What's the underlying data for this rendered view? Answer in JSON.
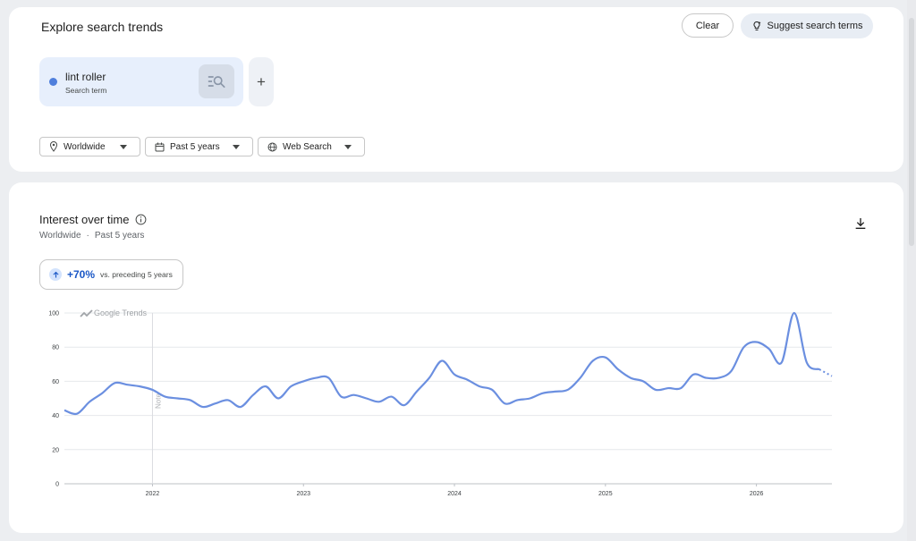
{
  "header": {
    "title": "Explore search trends",
    "clear_label": "Clear",
    "suggest_label": "Suggest search terms"
  },
  "term": {
    "name": "lint roller",
    "type_label": "Search term",
    "color": "#4f7fdc",
    "add_symbol": "+"
  },
  "filters": {
    "geo": "Worldwide",
    "time": "Past 5 years",
    "property": "Web Search"
  },
  "interest": {
    "title": "Interest over time",
    "subtitle_geo": "Worldwide",
    "subtitle_sep": "·",
    "subtitle_time": "Past 5 years",
    "change_value": "+70%",
    "change_note": "vs. preceding 5 years",
    "watermark": "Google Trends",
    "note_label": "Note"
  },
  "icons": {
    "geo": "location-pin-icon",
    "time": "calendar-icon",
    "property": "globe-icon",
    "suggest": "sparkle-bulb-icon",
    "explore": "search-list-icon",
    "info": "info-icon",
    "download": "download-icon",
    "trend_up": "arrow-up-icon"
  },
  "chart_data": {
    "type": "line",
    "series": [
      {
        "color": "#6b8fe0",
        "points": [
          [
            "2021-06",
            43
          ],
          [
            "2021-07",
            41
          ],
          [
            "2021-08",
            48
          ],
          [
            "2021-09",
            53
          ],
          [
            "2021-10",
            59
          ],
          [
            "2021-11",
            58
          ],
          [
            "2021-12",
            57
          ],
          [
            "2022-01",
            55
          ],
          [
            "2022-02",
            51
          ],
          [
            "2022-03",
            50
          ],
          [
            "2022-04",
            49
          ],
          [
            "2022-05",
            45
          ],
          [
            "2022-06",
            47
          ],
          [
            "2022-07",
            49
          ],
          [
            "2022-08",
            45
          ],
          [
            "2022-09",
            52
          ],
          [
            "2022-10",
            57
          ],
          [
            "2022-11",
            50
          ],
          [
            "2022-12",
            57
          ],
          [
            "2023-01",
            60
          ],
          [
            "2023-02",
            62
          ],
          [
            "2023-03",
            62
          ],
          [
            "2023-04",
            51
          ],
          [
            "2023-05",
            52
          ],
          [
            "2023-06",
            50
          ],
          [
            "2023-07",
            48
          ],
          [
            "2023-08",
            51
          ],
          [
            "2023-09",
            46
          ],
          [
            "2023-10",
            54
          ],
          [
            "2023-11",
            62
          ],
          [
            "2023-12",
            72
          ],
          [
            "2024-01",
            64
          ],
          [
            "2024-02",
            61
          ],
          [
            "2024-03",
            57
          ],
          [
            "2024-04",
            55
          ],
          [
            "2024-05",
            47
          ],
          [
            "2024-06",
            49
          ],
          [
            "2024-07",
            50
          ],
          [
            "2024-08",
            53
          ],
          [
            "2024-09",
            54
          ],
          [
            "2024-10",
            55
          ],
          [
            "2024-11",
            62
          ],
          [
            "2024-12",
            72
          ],
          [
            "2025-01",
            74
          ],
          [
            "2025-02",
            67
          ],
          [
            "2025-03",
            62
          ],
          [
            "2025-04",
            60
          ],
          [
            "2025-05",
            55
          ],
          [
            "2025-06",
            56
          ],
          [
            "2025-07",
            56
          ],
          [
            "2025-08",
            64
          ],
          [
            "2025-09",
            62
          ],
          [
            "2025-10",
            62
          ],
          [
            "2025-11",
            66
          ],
          [
            "2025-12",
            80
          ],
          [
            "2026-01",
            83
          ],
          [
            "2026-02",
            79
          ],
          [
            "2026-03",
            71
          ],
          [
            "2026-04",
            100
          ],
          [
            "2026-05",
            71
          ],
          [
            "2026-06",
            67
          ]
        ],
        "partial_points": [
          [
            "2026-06",
            67
          ],
          [
            "2026-07",
            63
          ]
        ]
      }
    ],
    "x_range": [
      "2021-06",
      "2026-07"
    ],
    "x_ticks": [
      "2022",
      "2023",
      "2024",
      "2025",
      "2026"
    ],
    "y_ticks": [
      0,
      20,
      40,
      60,
      80,
      100
    ],
    "ylim": [
      0,
      100
    ],
    "grid": true,
    "annotation": {
      "label": "Note",
      "x": "2022-01"
    }
  }
}
